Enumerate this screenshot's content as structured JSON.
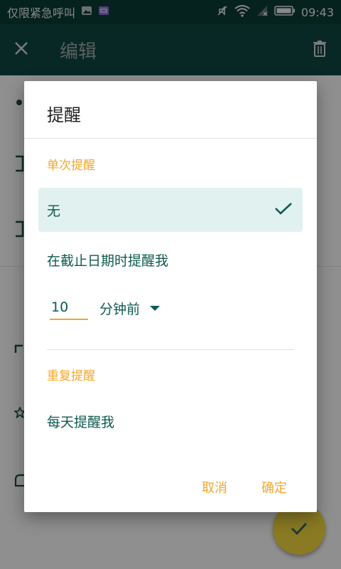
{
  "status_bar": {
    "carrier": "仅限紧急呼叫",
    "time": "09:43",
    "icons": [
      "image-icon",
      "message-icon",
      "mute-icon",
      "wifi-icon",
      "signal-icon",
      "battery-icon"
    ]
  },
  "toolbar": {
    "title": "编辑",
    "close_icon": "close-icon",
    "delete_icon": "trash-icon"
  },
  "dialog": {
    "title": "提醒",
    "single_section": "单次提醒",
    "options": {
      "none": "无",
      "at_due": "在截止日期时提醒我"
    },
    "minutes": {
      "value": "10",
      "unit": "分钟前"
    },
    "repeat_section": "重复提醒",
    "repeat_option": "每天提醒我",
    "cancel": "取消",
    "confirm": "确定"
  },
  "colors": {
    "status_bar": "#0b3b35",
    "toolbar": "#0d453e",
    "accent": "#f2a72b",
    "primary_text": "#0d5a4f",
    "selected_bg": "#e1f1ef"
  }
}
